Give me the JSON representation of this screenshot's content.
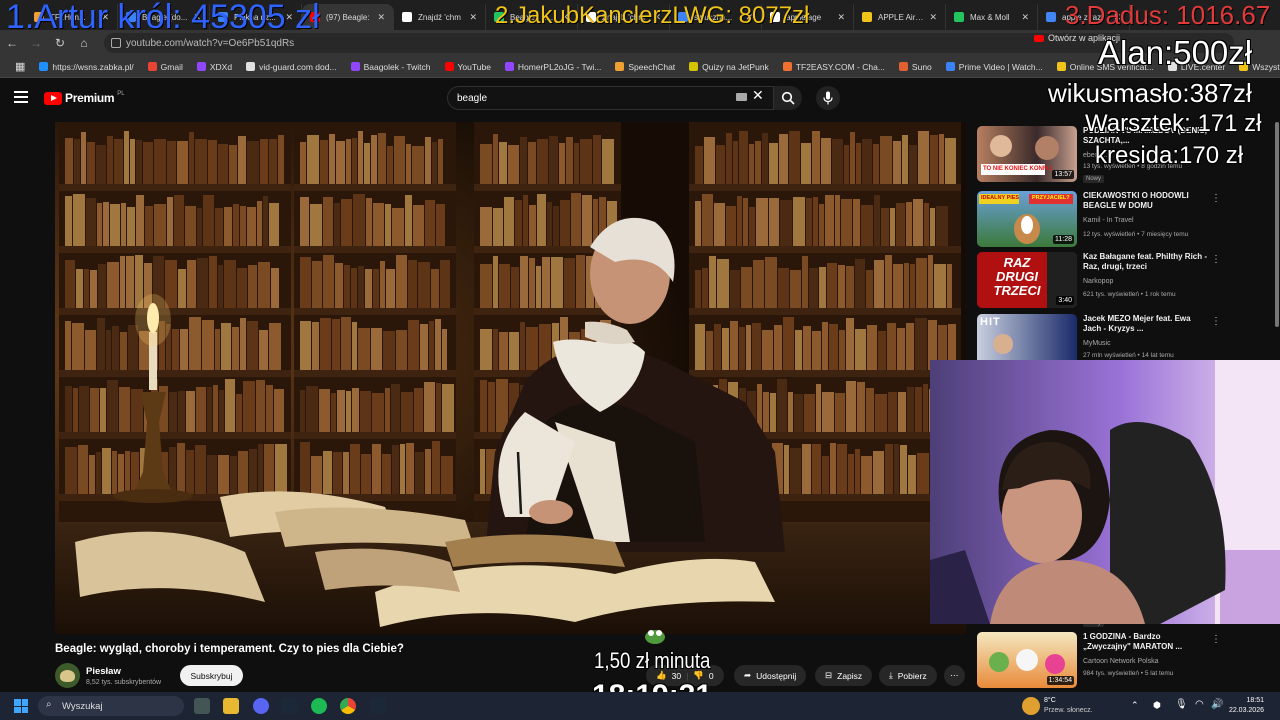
{
  "browser": {
    "tabs": [
      {
        "label": "TF2Hun...",
        "color": "#f0a030"
      },
      {
        "label": "Beagle (do...",
        "color": "#3b82f6"
      },
      {
        "label": "Piekna dz...",
        "color": "#3b82f6"
      },
      {
        "label": "(97) Beagle:",
        "color": "#ff0000"
      },
      {
        "label": "Znajdź 'chm",
        "color": "#ffffff"
      },
      {
        "label": "Beagle - n...",
        "color": "#22c55e"
      },
      {
        "label": "Znajdź 'chm",
        "color": "#ffffff"
      },
      {
        "label": "sztuczna...",
        "color": "#3b82f6"
      },
      {
        "label": "apple age",
        "color": "#ffffff"
      },
      {
        "label": "APPLE AirTa",
        "color": "#f0c419"
      },
      {
        "label": "Max & Moll",
        "color": "#22c55e"
      },
      {
        "label": "apple z razy",
        "color": "#4285f4"
      }
    ],
    "url": "youtube.com/watch?v=Oe6Pb51qdRs",
    "open_in_app": "Otwórz w aplikacji",
    "bookmarks": [
      {
        "label": "https://wsns.zabka.pl/",
        "color": "#1e90ff"
      },
      {
        "label": "Gmail",
        "color": "#ea4335"
      },
      {
        "label": "XDXd",
        "color": "#9146ff"
      },
      {
        "label": "vid-guard.com dod...",
        "color": "#e0e0e0"
      },
      {
        "label": "Baagolek - Twitch",
        "color": "#9146ff"
      },
      {
        "label": "YouTube",
        "color": "#ff0000"
      },
      {
        "label": "HomerPL2oJG - Twi...",
        "color": "#9146ff"
      },
      {
        "label": "SpeechChat",
        "color": "#f0a030"
      },
      {
        "label": "Quizy na JetPunk",
        "color": "#d4c400"
      },
      {
        "label": "TF2EASY.COM - Cha...",
        "color": "#f07030"
      },
      {
        "label": "Suno",
        "color": "#e06030"
      },
      {
        "label": "Prime Video | Watch...",
        "color": "#3b82f6"
      },
      {
        "label": "Online SMS verificat...",
        "color": "#f0c419"
      },
      {
        "label": "LIVE.center",
        "color": "#e0e0e0"
      },
      {
        "label": "Wszystkie zakładki",
        "color": "#f0c419"
      }
    ]
  },
  "youtube": {
    "logo": "Premium",
    "logo_region": "PL",
    "search_value": "beagle",
    "video": {
      "title": "Beagle: wygląd, choroby i temperament. Czy to pies dla Ciebie?",
      "channel": "Piesław",
      "subscribers": "8,52 tys. subskrybentów",
      "subscribe_label": "Subskrybuj",
      "likes": "30",
      "dislikes": "0",
      "share_label": "Udostępnij",
      "save_label": "Zapisz",
      "download_label": "Pobierz"
    },
    "recommendations": [
      {
        "title": "PUDZIAN VS MAMEDOV (DENIS, SZACHTA,...",
        "channel": "eberw...",
        "meta": "13 tys. wyświetleń • 8 godzin temu",
        "duration": "13:57",
        "badge": "Nowy"
      },
      {
        "title": "CIEKAWOSTKI O HODOWLI BEAGLE W DOMU",
        "channel": "Kamil - In Travel",
        "meta": "12 tys. wyświetleń • 7 miesięcy temu",
        "duration": "11:28"
      },
      {
        "title": "Kaz Bałagane feat. Philthy Rich - Raz, drugi, trzeci",
        "channel": "Narkopop",
        "meta": "621 tys. wyświetleń • 1 rok temu",
        "duration": "3:40"
      },
      {
        "title": "Jacek MEZO Mejer feat. Ewa Jach - Kryzys ...",
        "channel": "MyMusic",
        "meta": "27 mln wyświetleń • 14 lat temu",
        "duration": ""
      },
      {
        "title": "1 GODZINA - Bardzo „Zwyczajny\" MARATON ...",
        "channel": "Cartoon Network Polska",
        "meta": "984 tys. wyświetleń • 5 lat temu",
        "duration": "1:34:54"
      }
    ],
    "hidden_badge": "Nowy"
  },
  "overlays": {
    "rank1": "1.Artur król: 45305 zł",
    "rank2": "2.JakubKanclerzLWG: 8077zł",
    "rank3": "3.Dadus: 1016.67",
    "donors": [
      "Alan:500zł",
      "wikusmasło:387zł",
      "Warsztek: 171 zł",
      "kresida:170 zł"
    ],
    "rate": "1,50 zł minuta",
    "timer": "18:19:31",
    "thumb_text_1": "TO NIE KONIEC KONFLI",
    "thumb_text_2": "RAZ DRUGI TRZECI",
    "thumb_text_3": "HIT",
    "thumb_text_4": "IDEALNY PIES",
    "thumb_text_5": "PRZYJACIEL?"
  },
  "taskbar": {
    "search_label": "Wyszukaj",
    "weather_temp": "8°C",
    "weather_desc": "Przew. słonecz.",
    "time": "18:51",
    "date": "22.03.2026"
  }
}
